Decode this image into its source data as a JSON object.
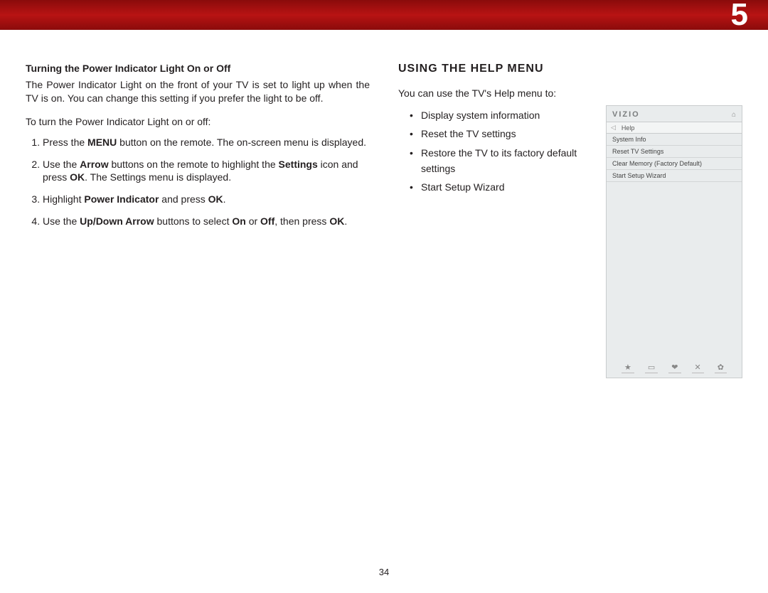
{
  "chapter": "5",
  "page_number": "34",
  "left": {
    "subhead": "Turning the Power Indicator Light On or Off",
    "para1": "The Power Indicator Light on the front of your TV is set to light up when the TV is on. You can change this setting if you prefer the light to be off.",
    "para2": "To turn the Power Indicator Light on or off:",
    "steps": [
      "Press the <b>MENU</b> button on the remote. The on-screen menu is displayed.",
      "Use the <b>Arrow</b> buttons on the remote to highlight the <b>Settings</b> icon and press <b>OK</b>. The Settings menu is displayed.",
      "Highlight <b>Power Indicator</b> and press <b>OK</b>.",
      "Use the <b>Up/Down Arrow</b> buttons to select <b>On</b> or <b>Off</b>, then press <b>OK</b>."
    ]
  },
  "right": {
    "title": "Using the Help Menu",
    "intro": "You can use the TV's Help menu to:",
    "bullets": [
      "Display system information",
      "Reset the TV settings",
      "Restore the TV to its factory default settings",
      "Start Setup Wizard"
    ]
  },
  "tv_menu": {
    "logo": "VIZIO",
    "crumb": "Help",
    "items": [
      "System Info",
      "Reset TV Settings",
      "Clear Memory (Factory Default)",
      "Start Setup Wizard"
    ]
  }
}
